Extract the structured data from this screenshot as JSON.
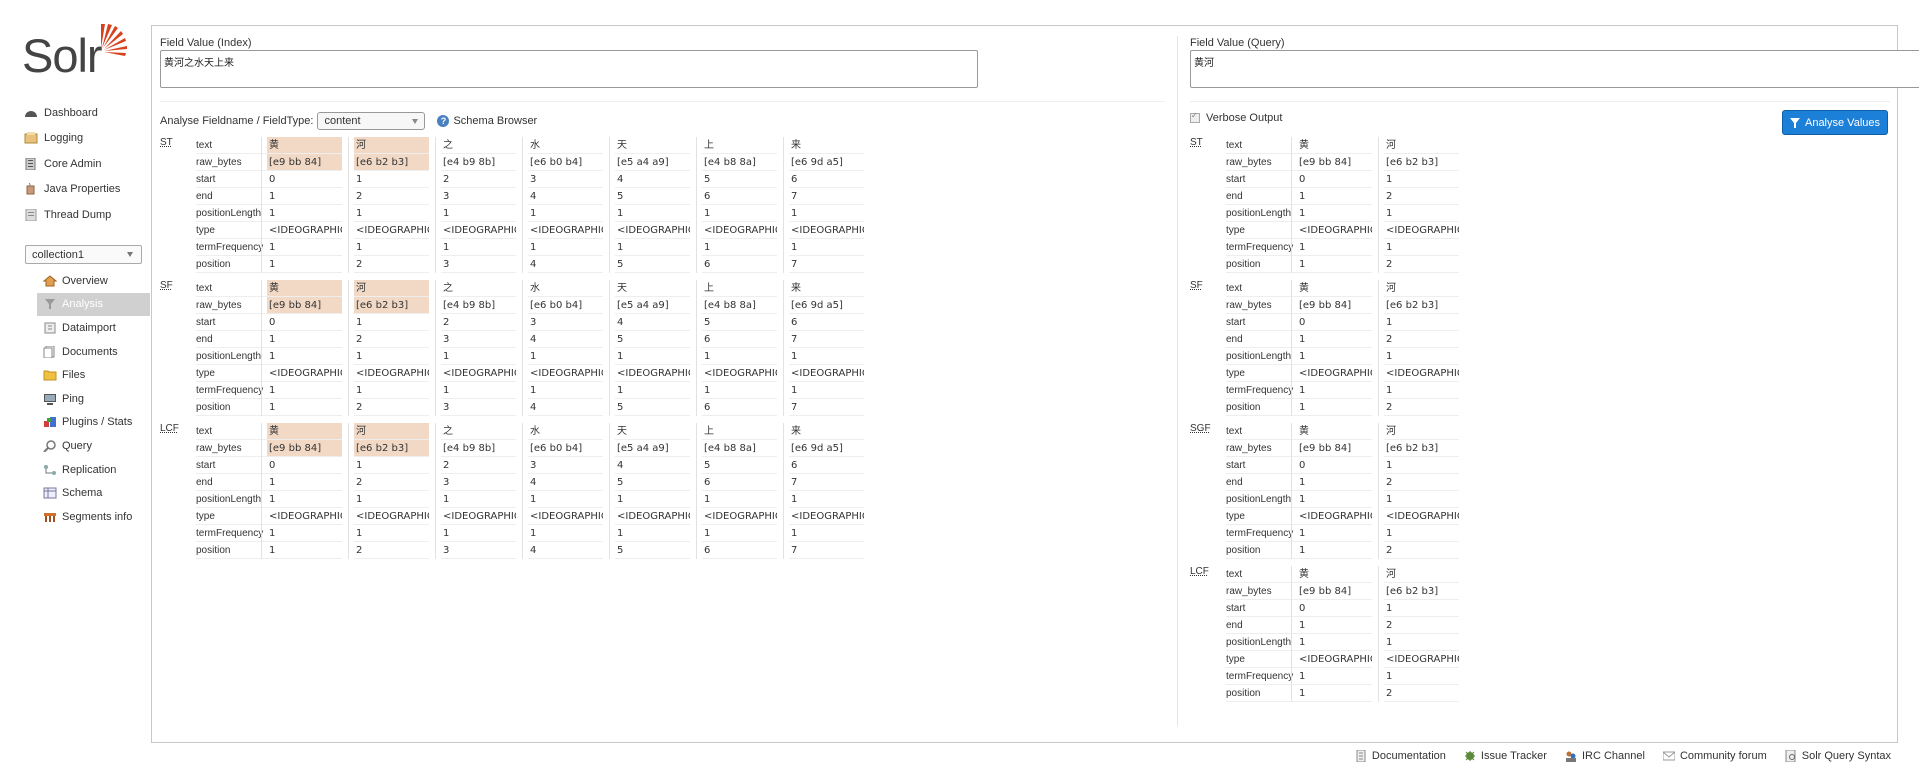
{
  "logo": {
    "text": "Solr"
  },
  "nav": [
    {
      "label": "Dashboard",
      "icon": "dashboard-icon"
    },
    {
      "label": "Logging",
      "icon": "logging-icon"
    },
    {
      "label": "Core Admin",
      "icon": "core-admin-icon"
    },
    {
      "label": "Java Properties",
      "icon": "java-properties-icon"
    },
    {
      "label": "Thread Dump",
      "icon": "thread-dump-icon"
    }
  ],
  "core_selector": {
    "value": "collection1"
  },
  "core_nav": [
    {
      "label": "Overview",
      "icon": "overview-icon"
    },
    {
      "label": "Analysis",
      "icon": "analysis-icon",
      "active": true
    },
    {
      "label": "Dataimport",
      "icon": "dataimport-icon"
    },
    {
      "label": "Documents",
      "icon": "documents-icon"
    },
    {
      "label": "Files",
      "icon": "files-icon"
    },
    {
      "label": "Ping",
      "icon": "ping-icon"
    },
    {
      "label": "Plugins / Stats",
      "icon": "plugins-icon"
    },
    {
      "label": "Query",
      "icon": "query-icon"
    },
    {
      "label": "Replication",
      "icon": "replication-icon"
    },
    {
      "label": "Schema",
      "icon": "schema-icon"
    },
    {
      "label": "Segments info",
      "icon": "segments-icon"
    }
  ],
  "analysis": {
    "index_label": "Field Value (Index)",
    "index_value": "黄河之水天上来",
    "query_label": "Field Value (Query)",
    "query_value": "黄河",
    "fieldtype_label": "Analyse Fieldname / FieldType:",
    "fieldtype_value": "content",
    "schema_browser": "Schema Browser",
    "verbose_label": "Verbose Output",
    "analyse_button": "Analyse Values"
  },
  "attributes": [
    "text",
    "raw_bytes",
    "start",
    "end",
    "positionLength",
    "type",
    "termFrequency",
    "position"
  ],
  "index_tokens": [
    {
      "text": "黄",
      "raw_bytes": "[e9 bb 84]",
      "start": "0",
      "end": "1",
      "positionLength": "1",
      "type": "<IDEOGRAPHIC>",
      "termFrequency": "1",
      "position": "1",
      "hl": true
    },
    {
      "text": "河",
      "raw_bytes": "[e6 b2 b3]",
      "start": "1",
      "end": "2",
      "positionLength": "1",
      "type": "<IDEOGRAPHIC>",
      "termFrequency": "1",
      "position": "2",
      "hl": true
    },
    {
      "text": "之",
      "raw_bytes": "[e4 b9 8b]",
      "start": "2",
      "end": "3",
      "positionLength": "1",
      "type": "<IDEOGRAPHIC>",
      "termFrequency": "1",
      "position": "3"
    },
    {
      "text": "水",
      "raw_bytes": "[e6 b0 b4]",
      "start": "3",
      "end": "4",
      "positionLength": "1",
      "type": "<IDEOGRAPHIC>",
      "termFrequency": "1",
      "position": "4"
    },
    {
      "text": "天",
      "raw_bytes": "[e5 a4 a9]",
      "start": "4",
      "end": "5",
      "positionLength": "1",
      "type": "<IDEOGRAPHIC>",
      "termFrequency": "1",
      "position": "5"
    },
    {
      "text": "上",
      "raw_bytes": "[e4 b8 8a]",
      "start": "5",
      "end": "6",
      "positionLength": "1",
      "type": "<IDEOGRAPHIC>",
      "termFrequency": "1",
      "position": "6"
    },
    {
      "text": "来",
      "raw_bytes": "[e6 9d a5]",
      "start": "6",
      "end": "7",
      "positionLength": "1",
      "type": "<IDEOGRAPHIC>",
      "termFrequency": "1",
      "position": "7"
    }
  ],
  "query_tokens": [
    {
      "text": "黄",
      "raw_bytes": "[e9 bb 84]",
      "start": "0",
      "end": "1",
      "positionLength": "1",
      "type": "<IDEOGRAPHIC>",
      "termFrequency": "1",
      "position": "1"
    },
    {
      "text": "河",
      "raw_bytes": "[e6 b2 b3]",
      "start": "1",
      "end": "2",
      "positionLength": "1",
      "type": "<IDEOGRAPHIC>",
      "termFrequency": "1",
      "position": "2"
    }
  ],
  "index_stages": [
    "ST",
    "SF",
    "LCF"
  ],
  "query_stages": [
    "ST",
    "SF",
    "SGF",
    "LCF"
  ],
  "footer": [
    {
      "label": "Documentation",
      "icon": "documentation-icon"
    },
    {
      "label": "Issue Tracker",
      "icon": "issue-tracker-icon"
    },
    {
      "label": "IRC Channel",
      "icon": "irc-channel-icon"
    },
    {
      "label": "Community forum",
      "icon": "community-forum-icon"
    },
    {
      "label": "Solr Query Syntax",
      "icon": "query-syntax-icon"
    }
  ]
}
